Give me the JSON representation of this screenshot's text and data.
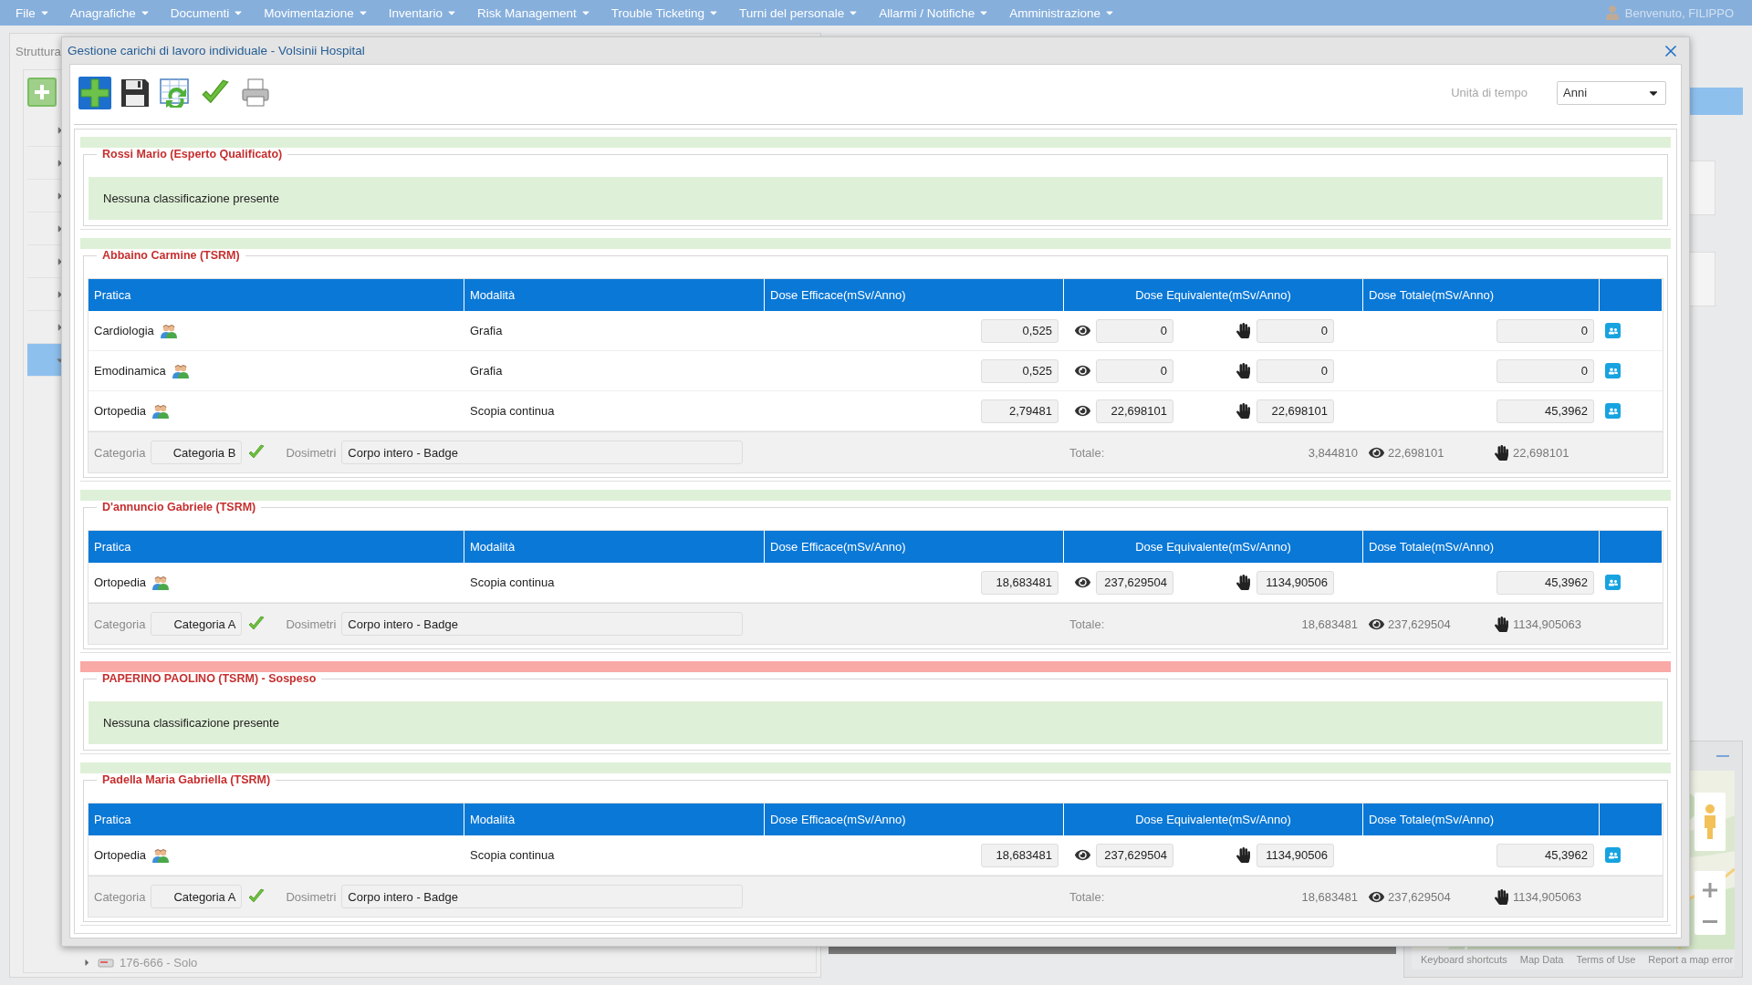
{
  "menu": [
    {
      "label": "File"
    },
    {
      "label": "Anagrafiche"
    },
    {
      "label": "Documenti"
    },
    {
      "label": "Movimentazione"
    },
    {
      "label": "Inventario"
    },
    {
      "label": "Risk Management"
    },
    {
      "label": "Trouble Ticketing"
    },
    {
      "label": "Turni del personale"
    },
    {
      "label": "Allarmi / Notifiche"
    },
    {
      "label": "Amministrazione"
    }
  ],
  "user": {
    "greeting": "Benvenuto, FILIPPO"
  },
  "background": {
    "panel_title": "Struttura",
    "tree_items": [
      {
        "selected": false
      },
      {
        "selected": false
      },
      {
        "selected": false
      },
      {
        "selected": false
      },
      {
        "selected": false
      },
      {
        "selected": false
      },
      {
        "selected": false
      },
      {
        "selected": true
      }
    ],
    "last_item": "176-666 - Solo",
    "map_links": [
      "Keyboard shortcuts",
      "Map Data",
      "Terms of Use",
      "Report a map error"
    ]
  },
  "dialog": {
    "title": "Gestione carichi di lavoro individuale - Volsinii Hospital",
    "time_unit_label": "Unità di tempo",
    "time_unit": "Anni",
    "sections": [
      {
        "kind": "empty",
        "title": "Rossi Mario (Esperto Qualificato)",
        "suspended": false,
        "message": "Nessuna classificazione presente"
      },
      {
        "kind": "table",
        "title": "Abbaino Carmine (TSRM)",
        "suspended": false,
        "columns": [
          "Pratica",
          "Modalità",
          "Dose Efficace(mSv/Anno)",
          "Dose Equivalente(mSv/Anno)",
          "Dose Totale(mSv/Anno)"
        ],
        "rows": [
          {
            "pratica": "Cardiologia",
            "modalita": "Grafia",
            "efficace": "0,525",
            "equivalente_occhio": "0",
            "equivalente_mani": "0",
            "totale": "0"
          },
          {
            "pratica": "Emodinamica",
            "modalita": "Grafia",
            "efficace": "0,525",
            "equivalente_occhio": "0",
            "equivalente_mani": "0",
            "totale": "0"
          },
          {
            "pratica": "Ortopedia",
            "modalita": "Scopia continua",
            "efficace": "2,79481",
            "equivalente_occhio": "22,698101",
            "equivalente_mani": "22,698101",
            "totale": "45,3962"
          }
        ],
        "footer": {
          "categoria_label": "Categoria",
          "categoria": "Categoria B",
          "dosimetri_label": "Dosimetri",
          "dosimetri": "Corpo intero - Badge",
          "totale_label": "Totale:",
          "efficace": "3,844810",
          "occhio": "22,698101",
          "mani": "22,698101"
        }
      },
      {
        "kind": "table",
        "title": "D'annuncio Gabriele (TSRM)",
        "suspended": false,
        "columns": [
          "Pratica",
          "Modalità",
          "Dose Efficace(mSv/Anno)",
          "Dose Equivalente(mSv/Anno)",
          "Dose Totale(mSv/Anno)"
        ],
        "rows": [
          {
            "pratica": "Ortopedia",
            "modalita": "Scopia continua",
            "efficace": "18,683481",
            "equivalente_occhio": "237,629504",
            "equivalente_mani": "1134,90506",
            "totale": "45,3962"
          }
        ],
        "footer": {
          "categoria_label": "Categoria",
          "categoria": "Categoria A",
          "dosimetri_label": "Dosimetri",
          "dosimetri": "Corpo intero - Badge",
          "totale_label": "Totale:",
          "efficace": "18,683481",
          "occhio": "237,629504",
          "mani": "1134,905063"
        }
      },
      {
        "kind": "empty",
        "title": "PAPERINO PAOLINO (TSRM) - Sospeso",
        "suspended": true,
        "message": "Nessuna classificazione presente"
      },
      {
        "kind": "table",
        "title": "Padella Maria Gabriella (TSRM)",
        "suspended": false,
        "columns": [
          "Pratica",
          "Modalità",
          "Dose Efficace(mSv/Anno)",
          "Dose Equivalente(mSv/Anno)",
          "Dose Totale(mSv/Anno)"
        ],
        "rows": [
          {
            "pratica": "Ortopedia",
            "modalita": "Scopia continua",
            "efficace": "18,683481",
            "equivalente_occhio": "237,629504",
            "equivalente_mani": "1134,90506",
            "totale": "45,3962"
          }
        ],
        "footer": {
          "categoria_label": "Categoria",
          "categoria": "Categoria A",
          "dosimetri_label": "Dosimetri",
          "dosimetri": "Corpo intero - Badge",
          "totale_label": "Totale:",
          "efficace": "18,683481",
          "occhio": "237,629504",
          "mani": "1134,905063"
        }
      }
    ]
  }
}
